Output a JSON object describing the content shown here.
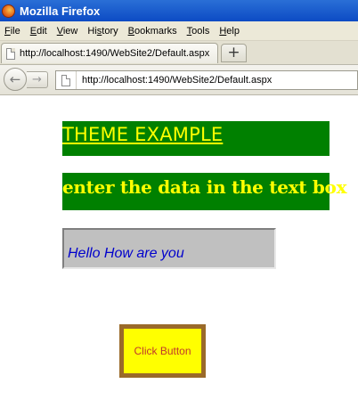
{
  "window": {
    "title": "Mozilla Firefox"
  },
  "menubar": {
    "items": [
      {
        "access_key": "F",
        "rest": "ile"
      },
      {
        "access_key": "E",
        "rest": "dit"
      },
      {
        "access_key": "V",
        "rest": "iew"
      },
      {
        "prefix": "Hi",
        "access_key": "s",
        "rest": "tory"
      },
      {
        "access_key": "B",
        "rest": "ookmarks"
      },
      {
        "access_key": "T",
        "rest": "ools"
      },
      {
        "access_key": "H",
        "rest": "elp"
      }
    ]
  },
  "tabs": [
    {
      "label": "http://localhost:1490/WebSite2/Default.aspx",
      "active": true
    }
  ],
  "newtab": {
    "label": "+"
  },
  "nav": {
    "back": "←",
    "forward": "→",
    "url": "http://localhost:1490/WebSite2/Default.aspx"
  },
  "content": {
    "banner": "THEME EXAMPLE",
    "subheading": "enter the data in the text box",
    "textbox_value": "Hello How are you",
    "button_label": "Click Button"
  },
  "colors": {
    "banner_bg": "#008000",
    "banner_text": "#ffff00",
    "textbox_bg": "#c0c0c0",
    "textbox_text": "#0000cc",
    "button_bg": "#ffff00",
    "button_border": "#9a6a2a",
    "button_text": "#c0392b"
  }
}
